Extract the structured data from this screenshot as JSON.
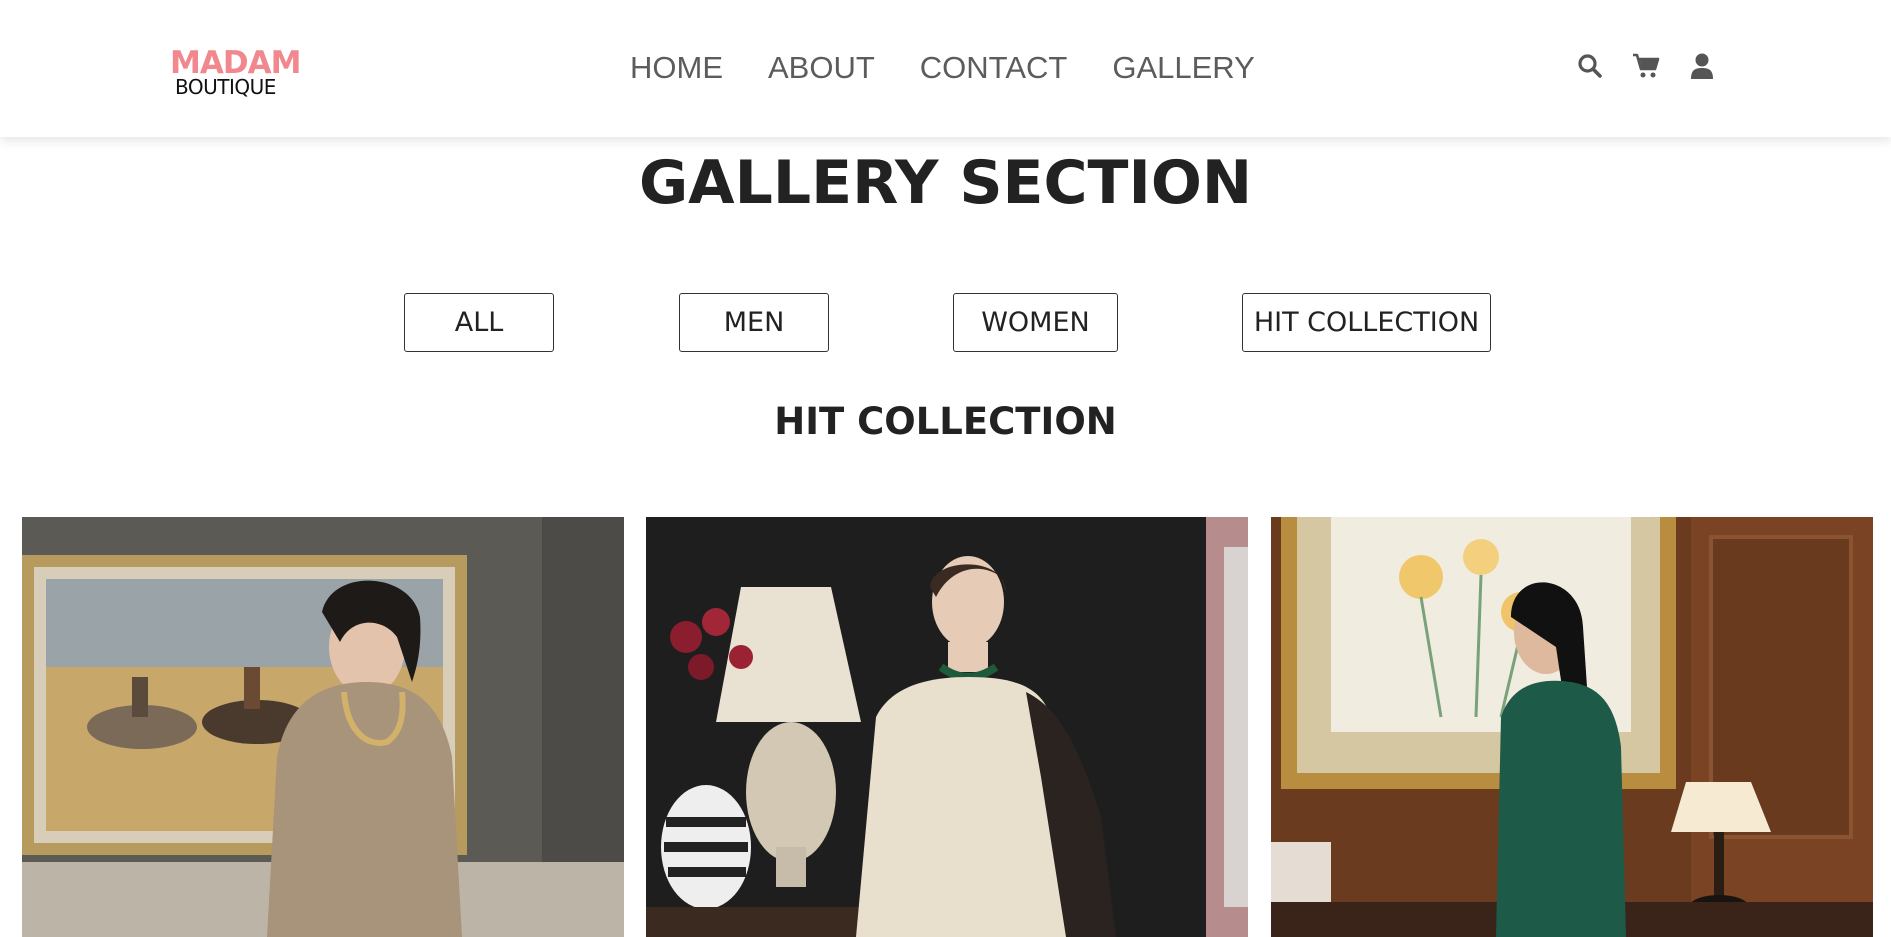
{
  "header": {
    "logo": {
      "line1": "MADAM",
      "line2": "BOUTIQUE",
      "color": "#f1888e"
    },
    "nav": [
      {
        "label": "HOME"
      },
      {
        "label": "ABOUT"
      },
      {
        "label": "CONTACT"
      },
      {
        "label": "GALLERY"
      }
    ],
    "icons": [
      "search-icon",
      "cart-icon",
      "user-icon"
    ]
  },
  "page": {
    "title": "GALLERY SECTION"
  },
  "filters": [
    {
      "label": "ALL"
    },
    {
      "label": "MEN"
    },
    {
      "label": "WOMEN"
    },
    {
      "label": "HIT COLLECTION"
    }
  ],
  "section": {
    "title": "HIT COLLECTION"
  },
  "gallery": [
    {
      "image": "woman-in-beige-dress-with-horse-painting"
    },
    {
      "image": "woman-in-ivory-dress-with-lamp"
    },
    {
      "image": "woman-in-green-dress-with-framed-painting"
    }
  ]
}
